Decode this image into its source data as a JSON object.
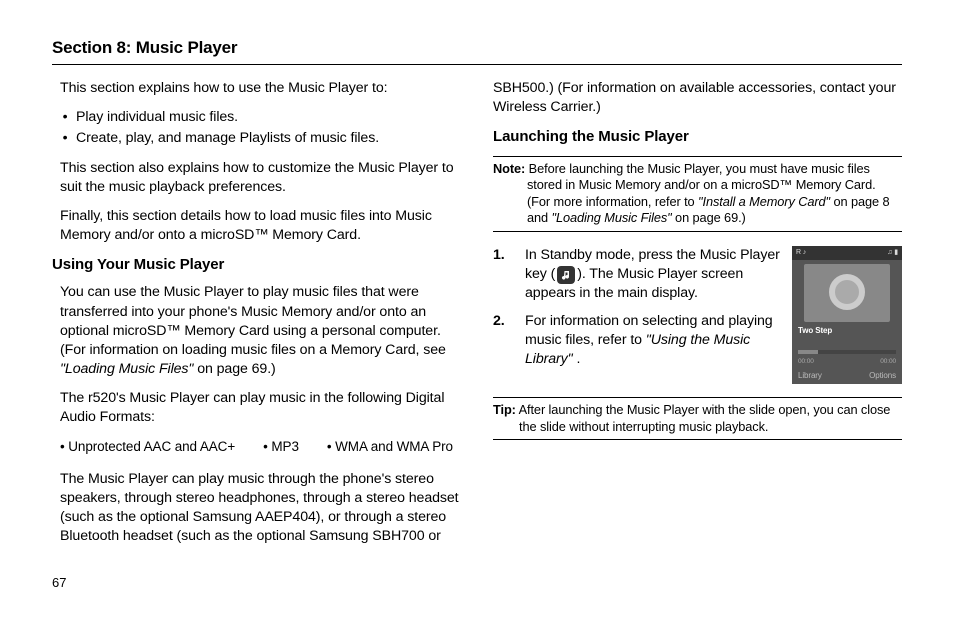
{
  "section_title": "Section 8: Music Player",
  "page_number": "67",
  "left": {
    "intro": "This section explains how to use the Music Player to:",
    "bullets": [
      "Play individual music files.",
      "Create, play, and manage Playlists of music files."
    ],
    "p2": "This section also explains how to customize the Music Player to suit the music playback preferences.",
    "p3": "Finally, this section details how to load music files into Music Memory and/or onto a microSD™ Memory Card.",
    "h_using": "Using Your Music Player",
    "using_p1a": "You can use the Music Player to play music files that were transferred into your phone's Music Memory and/or onto an optional microSD™ Memory Card using a personal computer. (For information on loading music files on a Memory Card, see ",
    "using_p1_ref": "\"Loading Music Files\"",
    "using_p1b": " on page 69.)",
    "using_p2": "The r520's Music Player can play music in the following Digital Audio Formats:",
    "formats": [
      "Unprotected AAC and AAC+",
      "MP3",
      "WMA and WMA Pro"
    ],
    "using_p3": "The Music Player can play music through the phone's stereo speakers, through stereo headphones, through a stereo headset (such as the optional Samsung AAEP404), or through a stereo Bluetooth headset (such as the optional Samsung SBH700 or"
  },
  "right": {
    "cont": "SBH500.) (For information on available accessories, contact your Wireless Carrier.)",
    "h_launch": "Launching the Music Player",
    "note_label": "Note:",
    "note_a": " Before launching the Music Player, you must have music files stored in Music Memory and/or on a microSD™ Memory Card. (For more information, refer to ",
    "note_ref1": "\"Install a Memory Card\"",
    "note_mid": "  on page 8 and ",
    "note_ref2": "\"Loading Music Files\"",
    "note_b": "  on page 69.)",
    "steps": [
      {
        "num": "1.",
        "a": "In Standby mode, press the Music Player key (",
        "b": "). The Music Player screen appears in the main display."
      },
      {
        "num": "2.",
        "a": "For information on selecting and playing music files, refer to ",
        "ref": "\"Using the Music Library\"",
        "b": " ."
      }
    ],
    "tip_label": "Tip:",
    "tip_text": " After launching the Music Player with the slide open, you can close the slide without interrupting music playback.",
    "shot": {
      "title": "Two Step",
      "soft_left": "Library",
      "soft_right": "Options"
    }
  }
}
